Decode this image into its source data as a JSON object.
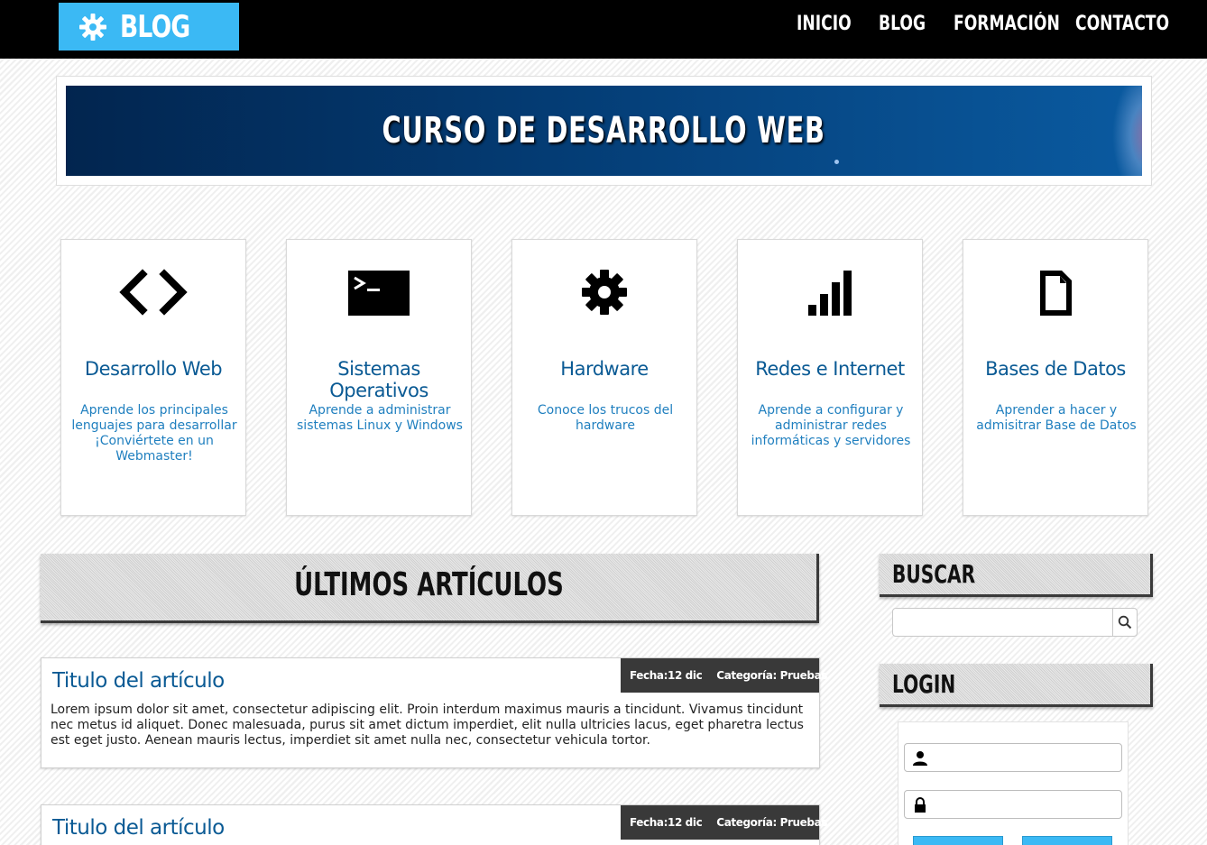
{
  "header": {
    "logo_text": "BLOG",
    "nav": [
      "INICIO",
      "BLOG",
      "FORMACIÓN",
      "CONTACTO"
    ]
  },
  "banner": {
    "title": "CURSO DE DESARROLLO WEB"
  },
  "cards": [
    {
      "icon": "code-icon",
      "title": "Desarrollo Web",
      "desc": "Aprende los principales lenguajes para desarrollar ¡Conviértete en un Webmaster!"
    },
    {
      "icon": "terminal-icon",
      "title": "Sistemas Operativos",
      "desc": "Aprende a administrar sistemas Linux y Windows"
    },
    {
      "icon": "gear-icon",
      "title": "Hardware",
      "desc": "Conoce los trucos del hardware"
    },
    {
      "icon": "signal-bars-icon",
      "title": "Redes e Internet",
      "desc": "Aprende a configurar y administrar redes informáticas y servidores"
    },
    {
      "icon": "document-icon",
      "title": "Bases de Datos",
      "desc": "Aprender a hacer y admisitrar Base de Datos"
    }
  ],
  "articles_heading": "ÚLTIMOS ARTÍCULOS",
  "articles": [
    {
      "title": "Titulo del artículo",
      "date_label": "Fecha:12 dic",
      "category_label": "Categoría: Pruebas",
      "body": "Lorem ipsum dolor sit amet, consectetur adipiscing elit. Proin interdum maximus mauris a tincidunt. Vivamus tincidunt nec metus id aliquet. Donec malesuada, purus sit amet dictum imperdiet, elit nulla ultricies lacus, eget pharetra lectus est eget justo. Aenean mauris lectus, imperdiet sit amet nulla nec, consectetur vehicula tortor."
    },
    {
      "title": "Titulo del artículo",
      "date_label": "Fecha:12 dic",
      "category_label": "Categoría: Pruebas",
      "body": ""
    }
  ],
  "sidebar": {
    "search_heading": "BUSCAR",
    "search_value": "",
    "login_heading": "LOGIN",
    "username_value": "",
    "password_value": ""
  },
  "colors": {
    "accent": "#3bb9f4",
    "link": "#0a5a94",
    "header_bg": "#000000",
    "meta_bg": "#393939"
  }
}
